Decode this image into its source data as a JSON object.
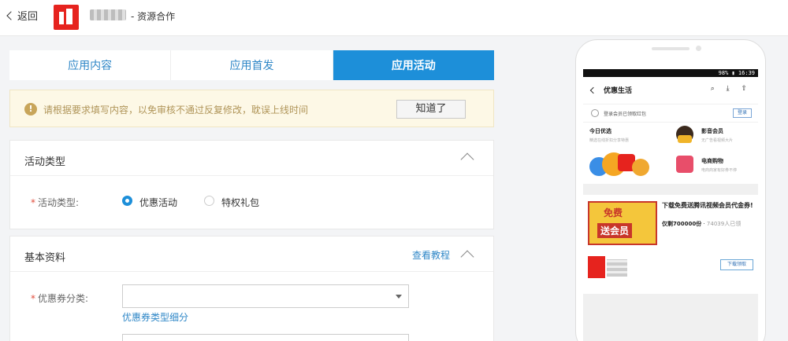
{
  "header": {
    "back_label": "返回",
    "breadcrumb": "-  资源合作"
  },
  "tabs": [
    {
      "label": "应用内容",
      "active": false
    },
    {
      "label": "应用首发",
      "active": false
    },
    {
      "label": "应用活动",
      "active": true
    }
  ],
  "notice": {
    "icon": "info-icon",
    "text": "请根据要求填写内容，以免审核不通过反复修改，耽误上线时间",
    "button": "知道了"
  },
  "activity_panel": {
    "title": "活动类型",
    "field_label": "活动类型:",
    "options": [
      {
        "label": "优惠活动",
        "selected": true
      },
      {
        "label": "特权礼包",
        "selected": false
      }
    ]
  },
  "basic_panel": {
    "title": "基本资料",
    "tutorial_link": "查看教程",
    "coupon_label": "优惠券分类:",
    "coupon_value": "",
    "coupon_link": "优惠券类型细分"
  },
  "phone": {
    "status": "98% ▮ 16:39",
    "title": "优惠生活",
    "icons": "⌕ ⤓ ⇧",
    "login_text": "登录会员已领取红包",
    "login_button": "登录",
    "cards": [
      {
        "title": "今日优选",
        "sub": "精选在线折扣分享特惠"
      },
      {
        "title": "影音会员",
        "sub": "无广告看视频大片"
      },
      {
        "title": "电商购物",
        "sub": "电商商家有好券不停"
      }
    ],
    "promo": {
      "image_top": "免费",
      "image_bottom": "送会员",
      "title": "下载免费送腾讯视频会员代金券!",
      "remaining": "仅剩700000份",
      "claimed": "74039人已领"
    },
    "gift_button": "下载领取"
  },
  "colors": {
    "accent": "#1d8fd9",
    "brand_red": "#e6231e",
    "notice_bg": "#fdf8e6"
  }
}
